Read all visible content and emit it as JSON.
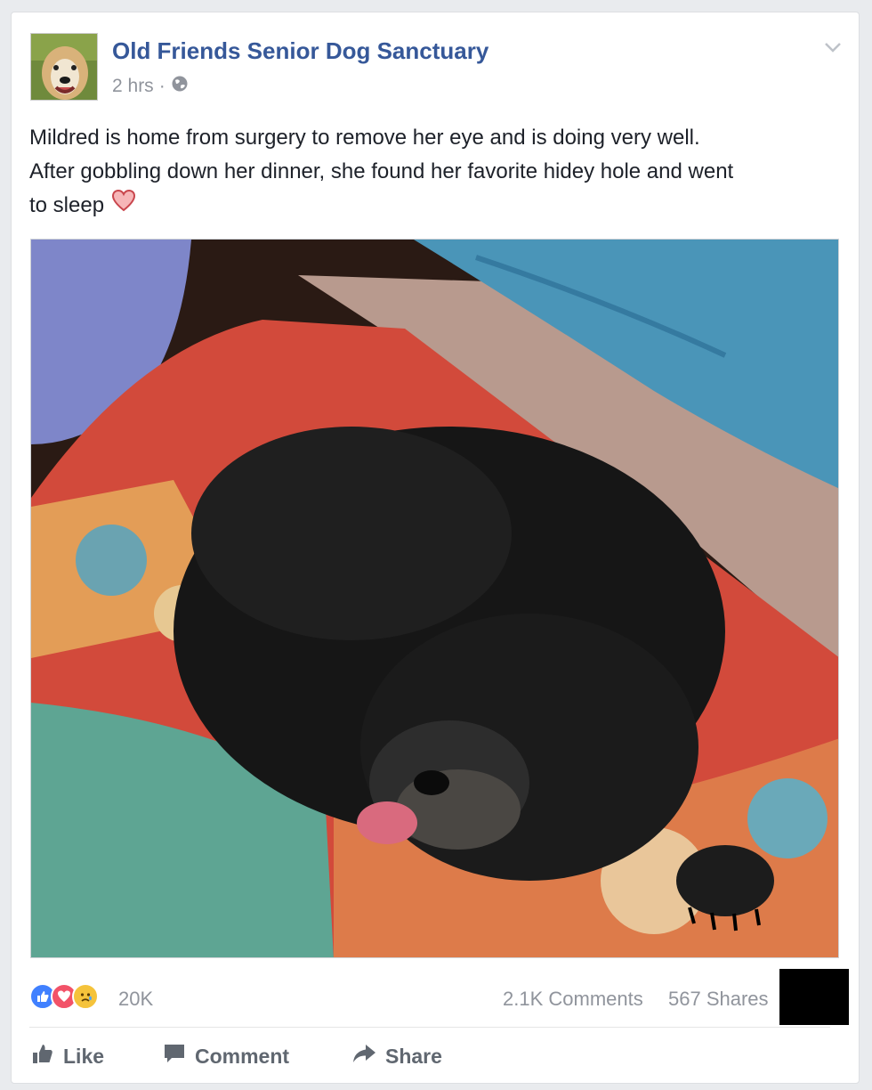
{
  "post": {
    "page_name": "Old Friends Senior Dog Sanctuary",
    "time": "2 hrs",
    "separator": "·",
    "audience_icon": "globe-icon",
    "menu_icon": "chevron-down-icon",
    "text_line1": "Mildred is home from surgery to remove her eye and is doing very well.",
    "text_line2": "After gobbling down her dinner, she found her favorite hidey hole and went",
    "text_line3": "to sleep",
    "text_emoji": "heart-outline-icon"
  },
  "stats": {
    "reaction_icons": [
      "like-reaction-icon",
      "love-reaction-icon",
      "sad-reaction-icon"
    ],
    "reactions": "20K",
    "comments": "2.1K Comments",
    "shares": "567 Shares"
  },
  "actions": {
    "like": "Like",
    "comment": "Comment",
    "share": "Share"
  },
  "colors": {
    "link": "#365899",
    "muted": "#90949c",
    "like_blue": "#4080ff",
    "love_red": "#f25268",
    "sad_yellow": "#f5c33b"
  }
}
